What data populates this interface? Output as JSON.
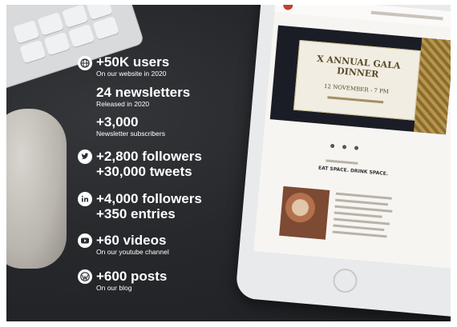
{
  "stats": [
    {
      "icon": "globe-icon",
      "headline": "+50K users",
      "caption": "On our website in 2020"
    },
    {
      "icon": "",
      "headline": "24 newsletters",
      "caption": "Released in 2020"
    },
    {
      "icon": "",
      "headline": "+3,000",
      "caption": "Newsletter subscribers"
    },
    {
      "icon": "twitter-icon",
      "headline": "+2,800 followers",
      "caption": "+30,000 tweets"
    },
    {
      "icon": "linkedin-icon",
      "headline": "+4,000 followers",
      "caption": "+350 entries"
    },
    {
      "icon": "youtube-icon",
      "headline": "+60 videos",
      "caption": "On our youtube channel"
    },
    {
      "icon": "wordpress-icon",
      "headline": "+600 posts",
      "caption": "On our blog"
    }
  ],
  "tablet": {
    "card_title": "X ANNUAL GALA DINNER",
    "card_date": "12 NOVEMBER - 7 PM",
    "section_heading": "EAT SPACE. DRINK SPACE."
  }
}
